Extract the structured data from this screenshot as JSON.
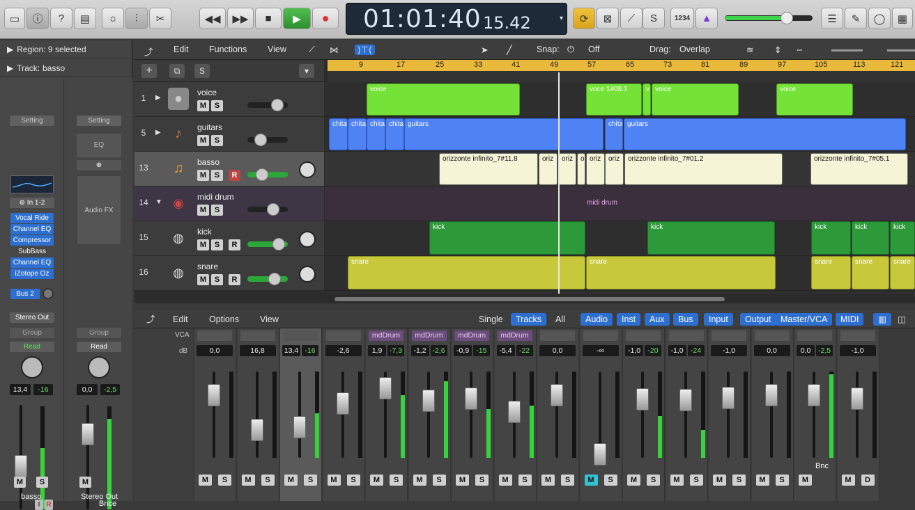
{
  "transport": {
    "time_main": "01:01:40",
    "time_sub": "15.42",
    "key_label": "1234"
  },
  "inspector": {
    "region_label": "Region: 9 selected",
    "track_label": "Track:",
    "track_name": "basso",
    "setting": "Setting",
    "input": "In 1-2",
    "plugins": [
      "Vocal Ride",
      "Channel EQ",
      "Compressor",
      "SubBass",
      "Channel EQ",
      "iZotope Oz"
    ],
    "send": "Bus 2",
    "output": "Stereo Out",
    "group": "Group",
    "automation": "Read",
    "db_values": [
      "13,4",
      "-16"
    ],
    "strip_name": "basso",
    "right_strip": {
      "setting": "Setting",
      "eq": "EQ",
      "audio_fx": "Audio FX",
      "group": "Group",
      "automation": "Read",
      "db_values": [
        "0,0",
        "-2,5"
      ],
      "bnce": "Bnce",
      "strip_name": "Stereo Out"
    }
  },
  "arrange_toolbar": {
    "edit": "Edit",
    "functions": "Functions",
    "view": "View",
    "snap_label": "Snap:",
    "snap_value": "Off",
    "drag_label": "Drag:",
    "drag_value": "Overlap"
  },
  "ruler": {
    "bars": [
      "9",
      "17",
      "25",
      "33",
      "41",
      "49",
      "57",
      "65",
      "73",
      "81",
      "89",
      "97",
      "105",
      "113",
      "121"
    ]
  },
  "tracks": [
    {
      "num": "1",
      "name": "voice",
      "m": "M",
      "s": "S"
    },
    {
      "num": "5",
      "name": "guitars",
      "m": "M",
      "s": "S"
    },
    {
      "num": "13",
      "name": "basso",
      "m": "M",
      "s": "S",
      "r": "R"
    },
    {
      "num": "14",
      "name": "midi drum",
      "m": "M",
      "s": "S"
    },
    {
      "num": "15",
      "name": "kick",
      "m": "M",
      "s": "S",
      "r": "R"
    },
    {
      "num": "16",
      "name": "snare",
      "m": "M",
      "s": "S",
      "r": "R"
    }
  ],
  "regions": {
    "voice": [
      "voice",
      "voce 1#08.1",
      "v",
      "voice",
      "voice"
    ],
    "guitars": [
      "chita",
      "chita",
      "chita",
      "chita",
      "guitars",
      "chita",
      "guitars"
    ],
    "basso": [
      "orizzonte infinito_7#11.8",
      "oriz",
      "oriz",
      "o",
      "oriz",
      "oriz",
      "orizzonte infinito_7#01.2",
      "orizzonte infinito_7#05.1"
    ],
    "midi_drum": "midi drum",
    "kick": [
      "kick",
      "kick",
      "kick",
      "kick",
      "kick"
    ],
    "snare": [
      "snare",
      "snare",
      "snare",
      "snare",
      "snare"
    ]
  },
  "mixer_toolbar": {
    "edit": "Edit",
    "options": "Options",
    "view": "View",
    "single": "Single",
    "tracks": "Tracks",
    "all": "All",
    "filters": [
      "Audio",
      "Inst",
      "Aux",
      "Bus",
      "Input",
      "Output",
      "Master/VCA",
      "MIDI"
    ]
  },
  "mixer": {
    "vca_label": "VCA",
    "db_label": "dB",
    "channels": [
      {
        "db": "0,0",
        "peak": "",
        "md": "",
        "m": "M",
        "s": "S"
      },
      {
        "db": "16,8",
        "peak": "",
        "md": "",
        "m": "M",
        "s": "S"
      },
      {
        "db": "13,4",
        "peak": "-16",
        "md": "",
        "m": "M",
        "s": "S"
      },
      {
        "db": "-2,6",
        "peak": "",
        "md": "",
        "m": "M",
        "s": "S"
      },
      {
        "db": "1,9",
        "peak": "-7,3",
        "md": "mdDrum",
        "m": "M",
        "s": "S"
      },
      {
        "db": "-1,2",
        "peak": "-2,6",
        "md": "mdDrum",
        "m": "M",
        "s": "S"
      },
      {
        "db": "-0,9",
        "peak": "-15",
        "md": "mdDrum",
        "m": "M",
        "s": "S"
      },
      {
        "db": "-5,4",
        "peak": "-22",
        "md": "mdDrum",
        "m": "M",
        "s": "S"
      },
      {
        "db": "0,0",
        "peak": "",
        "md": "",
        "m": "M",
        "s": "S"
      },
      {
        "db": "-∞",
        "peak": "",
        "md": "",
        "m": "M",
        "s": "S"
      },
      {
        "db": "-1,0",
        "peak": "-20",
        "md": "",
        "m": "M",
        "s": "S"
      },
      {
        "db": "-1,0",
        "peak": "-24",
        "md": "",
        "m": "M",
        "s": "S"
      },
      {
        "db": "-1,0",
        "peak": "",
        "md": "",
        "m": "M",
        "s": "S"
      },
      {
        "db": "0,0",
        "peak": "",
        "md": "",
        "m": "M",
        "s": "S"
      },
      {
        "db": "0,0",
        "peak": "-2,5",
        "md": "",
        "m": "M",
        "s": "Bnc"
      },
      {
        "db": "-1,0",
        "peak": "",
        "md": "",
        "m": "M",
        "s": "D"
      }
    ]
  },
  "colors": {
    "accent_blue": "#2d6fd0",
    "play_green": "#3aa53c",
    "record_red": "#e03030",
    "ruler_yellow": "#e9b93b",
    "region_green": "#75e237",
    "region_blue": "#4f82f3"
  }
}
